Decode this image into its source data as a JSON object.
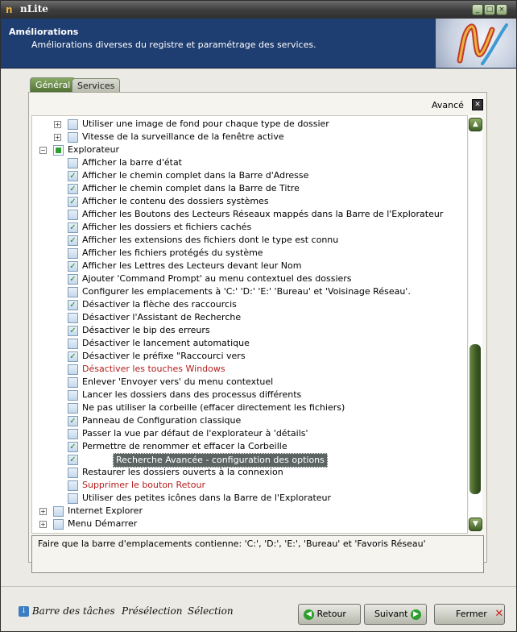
{
  "app": {
    "title": "nLite"
  },
  "header": {
    "title": "Améliorations",
    "subtitle": "Améliorations diverses du registre et paramétrage des services."
  },
  "tabs": [
    {
      "label": "Général",
      "active": true
    },
    {
      "label": "Services",
      "active": false
    }
  ],
  "advanced": {
    "label": "Avancé"
  },
  "tree": [
    {
      "label": "Utiliser une image de fond pour chaque type de dossier",
      "level": 2,
      "checked": false,
      "expandable": true
    },
    {
      "label": "Vitesse de la surveillance de la fenêtre active",
      "level": 2,
      "checked": false,
      "expandable": true
    },
    {
      "label": "Explorateur",
      "level": 1,
      "checked": "partial",
      "expandable": true,
      "expanded": true
    },
    {
      "label": "Afficher la barre d'état",
      "level": 2,
      "checked": false
    },
    {
      "label": "Afficher le chemin complet dans la Barre d'Adresse",
      "level": 2,
      "checked": true
    },
    {
      "label": "Afficher le chemin complet dans la Barre de Titre",
      "level": 2,
      "checked": true
    },
    {
      "label": "Afficher le contenu des dossiers systèmes",
      "level": 2,
      "checked": true
    },
    {
      "label": "Afficher les Boutons des Lecteurs Réseaux mappés dans la Barre de l'Explorateur",
      "level": 2,
      "checked": false
    },
    {
      "label": "Afficher les dossiers et fichiers cachés",
      "level": 2,
      "checked": true
    },
    {
      "label": "Afficher les extensions des fichiers dont le type est connu",
      "level": 2,
      "checked": true
    },
    {
      "label": "Afficher les fichiers protégés du système",
      "level": 2,
      "checked": false
    },
    {
      "label": "Afficher les Lettres des Lecteurs devant leur Nom",
      "level": 2,
      "checked": true
    },
    {
      "label": "Ajouter 'Command Prompt' au menu contextuel des dossiers",
      "level": 2,
      "checked": true
    },
    {
      "label": "Configurer les emplacements à 'C:' 'D:' 'E:' 'Bureau' et 'Voisinage Réseau'.",
      "level": 2,
      "checked": false
    },
    {
      "label": "Désactiver la flèche des raccourcis",
      "level": 2,
      "checked": true
    },
    {
      "label": "Désactiver l'Assistant de Recherche",
      "level": 2,
      "checked": false
    },
    {
      "label": "Désactiver le bip des erreurs",
      "level": 2,
      "checked": true
    },
    {
      "label": "Désactiver le lancement automatique",
      "level": 2,
      "checked": false
    },
    {
      "label": "Désactiver le préfixe \"Raccourci vers",
      "level": 2,
      "checked": true
    },
    {
      "label": "Désactiver les touches Windows",
      "level": 2,
      "checked": false,
      "style": "red"
    },
    {
      "label": "Enlever 'Envoyer vers' du menu contextuel",
      "level": 2,
      "checked": false
    },
    {
      "label": "Lancer les dossiers dans des processus différents",
      "level": 2,
      "checked": false
    },
    {
      "label": "Ne pas utiliser la corbeille (effacer directement les fichiers)",
      "level": 2,
      "checked": false
    },
    {
      "label": "Panneau de Configuration classique",
      "level": 2,
      "checked": true
    },
    {
      "label": "Passer la vue par défaut de l'explorateur à 'détails'",
      "level": 2,
      "checked": false
    },
    {
      "label": "Permettre de renommer et effacer la Corbeille",
      "level": 2,
      "checked": true
    },
    {
      "label": "Recherche Avancée - configuration des options",
      "level": 2,
      "checked": true,
      "style": "selected"
    },
    {
      "label": "Restaurer les dossiers ouverts à la connexion",
      "level": 2,
      "checked": false
    },
    {
      "label": "Supprimer le bouton Retour",
      "level": 2,
      "checked": false,
      "style": "red"
    },
    {
      "label": "Utiliser des petites icônes dans la Barre de l'Explorateur",
      "level": 2,
      "checked": false
    },
    {
      "label": "Internet Explorer",
      "level": 1,
      "checked": false,
      "expandable": true
    },
    {
      "label": "Menu Démarrer",
      "level": 1,
      "checked": false,
      "expandable": true
    }
  ],
  "scrollbar": {
    "position": 0.72
  },
  "description": "Faire que la barre d'emplacements contienne: 'C:', 'D:', 'E:', 'Bureau' et 'Favoris Réseau'",
  "footer": {
    "taskbar": "Barre des tâches",
    "preselection": "Présélection",
    "selection": "Sélection",
    "back": "Retour",
    "next": "Suivant",
    "close": "Fermer"
  },
  "colors": {
    "accent": "#4e6f33",
    "header": "#1e3d70",
    "red_item": "#b41c1c"
  }
}
